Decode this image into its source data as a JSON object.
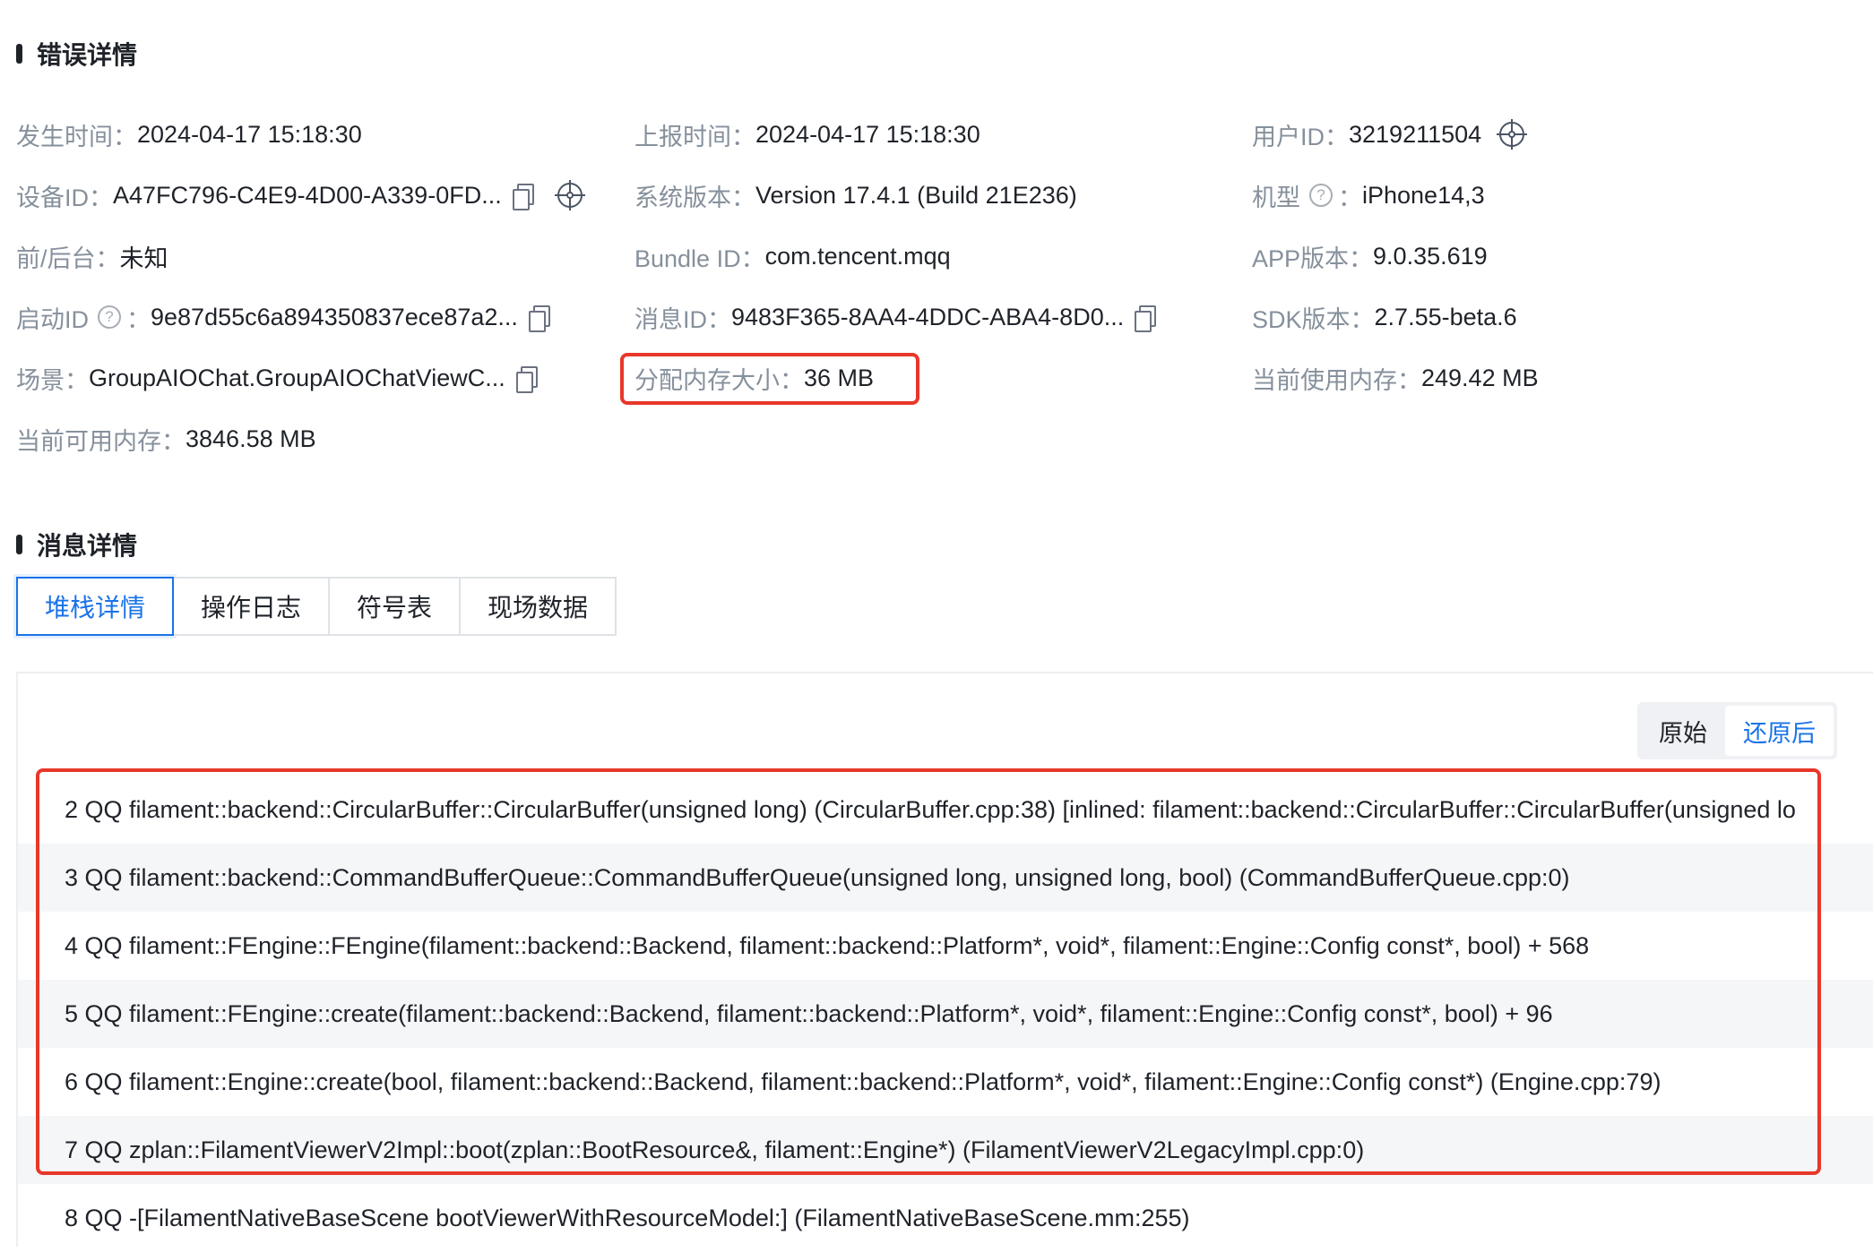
{
  "error_section": {
    "title": "错误详情",
    "fields": [
      {
        "key": "发生时间：",
        "value": "2024-04-17 15:18:30"
      },
      {
        "key": "上报时间：",
        "value": "2024-04-17 15:18:30"
      },
      {
        "key": "用户ID：",
        "value": "3219211504"
      },
      {
        "key": "设备ID：",
        "value": "A47FC796-C4E9-4D00-A339-0FD..."
      },
      {
        "key": "系统版本：",
        "value": "Version 17.4.1 (Build 21E236)"
      },
      {
        "key": "机型",
        "value": "iPhone14,3"
      },
      {
        "key": "前/后台：",
        "value": "未知"
      },
      {
        "key": "Bundle ID：",
        "value": "com.tencent.mqq"
      },
      {
        "key": "APP版本：",
        "value": "9.0.35.619"
      },
      {
        "key": "启动ID",
        "value": "9e87d55c6a894350837ece87a2..."
      },
      {
        "key": "消息ID：",
        "value": "9483F365-8AA4-4DDC-ABA4-8D0..."
      },
      {
        "key": "SDK版本：",
        "value": "2.7.55-beta.6"
      },
      {
        "key": "场景：",
        "value": "GroupAIOChat.GroupAIOChatViewC..."
      },
      {
        "key": "分配内存大小：",
        "value": "36 MB"
      },
      {
        "key": "当前使用内存：",
        "value": "249.42 MB"
      },
      {
        "key": "当前可用内存：",
        "value": "3846.58 MB"
      }
    ],
    "colon": "："
  },
  "message_section": {
    "title": "消息详情",
    "tabs": [
      "堆栈详情",
      "操作日志",
      "符号表",
      "现场数据"
    ],
    "active_tab": "堆栈详情"
  },
  "stack_view": {
    "toggle": [
      "原始",
      "还原后"
    ],
    "toggle_active": "还原后",
    "rows": [
      "2 QQ filament::backend::CircularBuffer::CircularBuffer(unsigned long) (CircularBuffer.cpp:38) [inlined: filament::backend::CircularBuffer::CircularBuffer(unsigned lo",
      "3 QQ filament::backend::CommandBufferQueue::CommandBufferQueue(unsigned long, unsigned long, bool) (CommandBufferQueue.cpp:0)",
      "4 QQ filament::FEngine::FEngine(filament::backend::Backend, filament::backend::Platform*, void*, filament::Engine::Config const*, bool) + 568",
      "5 QQ filament::FEngine::create(filament::backend::Backend, filament::backend::Platform*, void*, filament::Engine::Config const*, bool) + 96",
      "6 QQ filament::Engine::create(bool, filament::backend::Backend, filament::backend::Platform*, void*, filament::Engine::Config const*) (Engine.cpp:79)",
      "7 QQ zplan::FilamentViewerV2Impl::boot(zplan::BootResource&, filament::Engine*) (FilamentViewerV2LegacyImpl.cpp:0)",
      "8 QQ -[FilamentNativeBaseScene bootViewerWithResourceModel:] (FilamentNativeBaseScene.mm:255)"
    ]
  },
  "colors": {
    "accent": "#1a73e8",
    "highlight": "#e8372a",
    "muted": "#86909c"
  }
}
